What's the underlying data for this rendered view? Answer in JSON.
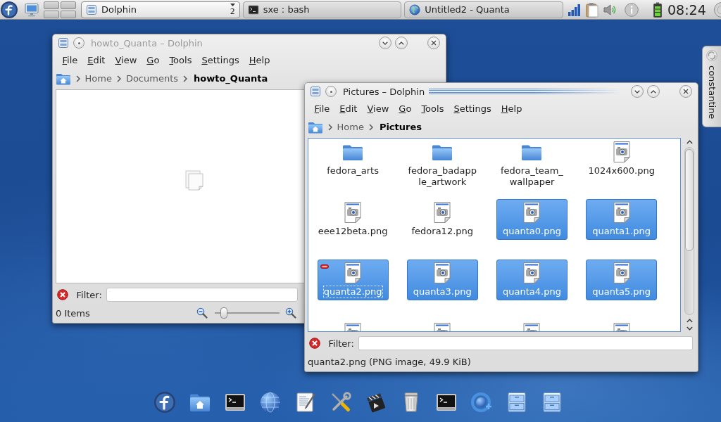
{
  "panel": {
    "taskbar": [
      {
        "kind": "files",
        "label": "Dolphin",
        "count": "2",
        "selected": true
      },
      {
        "kind": "terminal",
        "label": "sxe : bash",
        "selected": false
      },
      {
        "kind": "web",
        "label": "Untitled2 - Quanta",
        "selected": false
      }
    ],
    "clock": "08:24"
  },
  "side_tab": {
    "label": "constantine"
  },
  "windows": [
    {
      "title": "howto_Quanta – Dolphin",
      "active": false,
      "menu": [
        "File",
        "Edit",
        "View",
        "Go",
        "Tools",
        "Settings",
        "Help"
      ],
      "breadcrumb": [
        "Home",
        "Documents",
        "howto_Quanta"
      ],
      "view": {
        "kind": "empty"
      },
      "filter": {
        "label": "Filter:"
      },
      "status": {
        "text": "0 Items",
        "zoom": {
          "level": 0.1
        }
      }
    },
    {
      "title": "Pictures – Dolphin",
      "active": true,
      "menu": [
        "File",
        "Edit",
        "View",
        "Go",
        "Tools",
        "Settings",
        "Help"
      ],
      "breadcrumb": [
        "Home",
        "Pictures"
      ],
      "view": {
        "kind": "icons",
        "items": [
          {
            "name": "fedora_arts",
            "kind": "folder",
            "selected": false,
            "focused": false,
            "hovered": false
          },
          {
            "name": "fedora_badapple_artwork",
            "kind": "folder",
            "selected": false,
            "focused": false,
            "hovered": false
          },
          {
            "name": "fedora_team_wallpaper",
            "kind": "folder",
            "selected": false,
            "focused": false,
            "hovered": false
          },
          {
            "name": "1024x600.png",
            "kind": "image",
            "selected": false,
            "focused": false,
            "hovered": false
          },
          {
            "name": "eee12beta.png",
            "kind": "image",
            "selected": false,
            "focused": false,
            "hovered": false
          },
          {
            "name": "fedora12.png",
            "kind": "image",
            "selected": false,
            "focused": false,
            "hovered": false
          },
          {
            "name": "quanta0.png",
            "kind": "image",
            "selected": true,
            "focused": false,
            "hovered": false
          },
          {
            "name": "quanta1.png",
            "kind": "image",
            "selected": true,
            "focused": false,
            "hovered": false
          },
          {
            "name": "quanta2.png",
            "kind": "image",
            "selected": true,
            "focused": true,
            "hovered": true
          },
          {
            "name": "quanta3.png",
            "kind": "image",
            "selected": true,
            "focused": false,
            "hovered": false
          },
          {
            "name": "quanta4.png",
            "kind": "image",
            "selected": true,
            "focused": false,
            "hovered": false
          },
          {
            "name": "quanta5.png",
            "kind": "image",
            "selected": true,
            "focused": false,
            "hovered": false
          },
          {
            "kind": "image",
            "selected": false,
            "focused": false,
            "hovered": false
          },
          {
            "kind": "image",
            "selected": false,
            "focused": false,
            "hovered": false
          },
          {
            "kind": "image",
            "selected": false,
            "focused": false,
            "hovered": false
          },
          {
            "kind": "image",
            "selected": false,
            "focused": false,
            "hovered": false
          }
        ]
      },
      "filter": {
        "label": "Filter:"
      },
      "status": {
        "text": "quanta2.png (PNG image, 49.9 KiB)"
      }
    }
  ]
}
